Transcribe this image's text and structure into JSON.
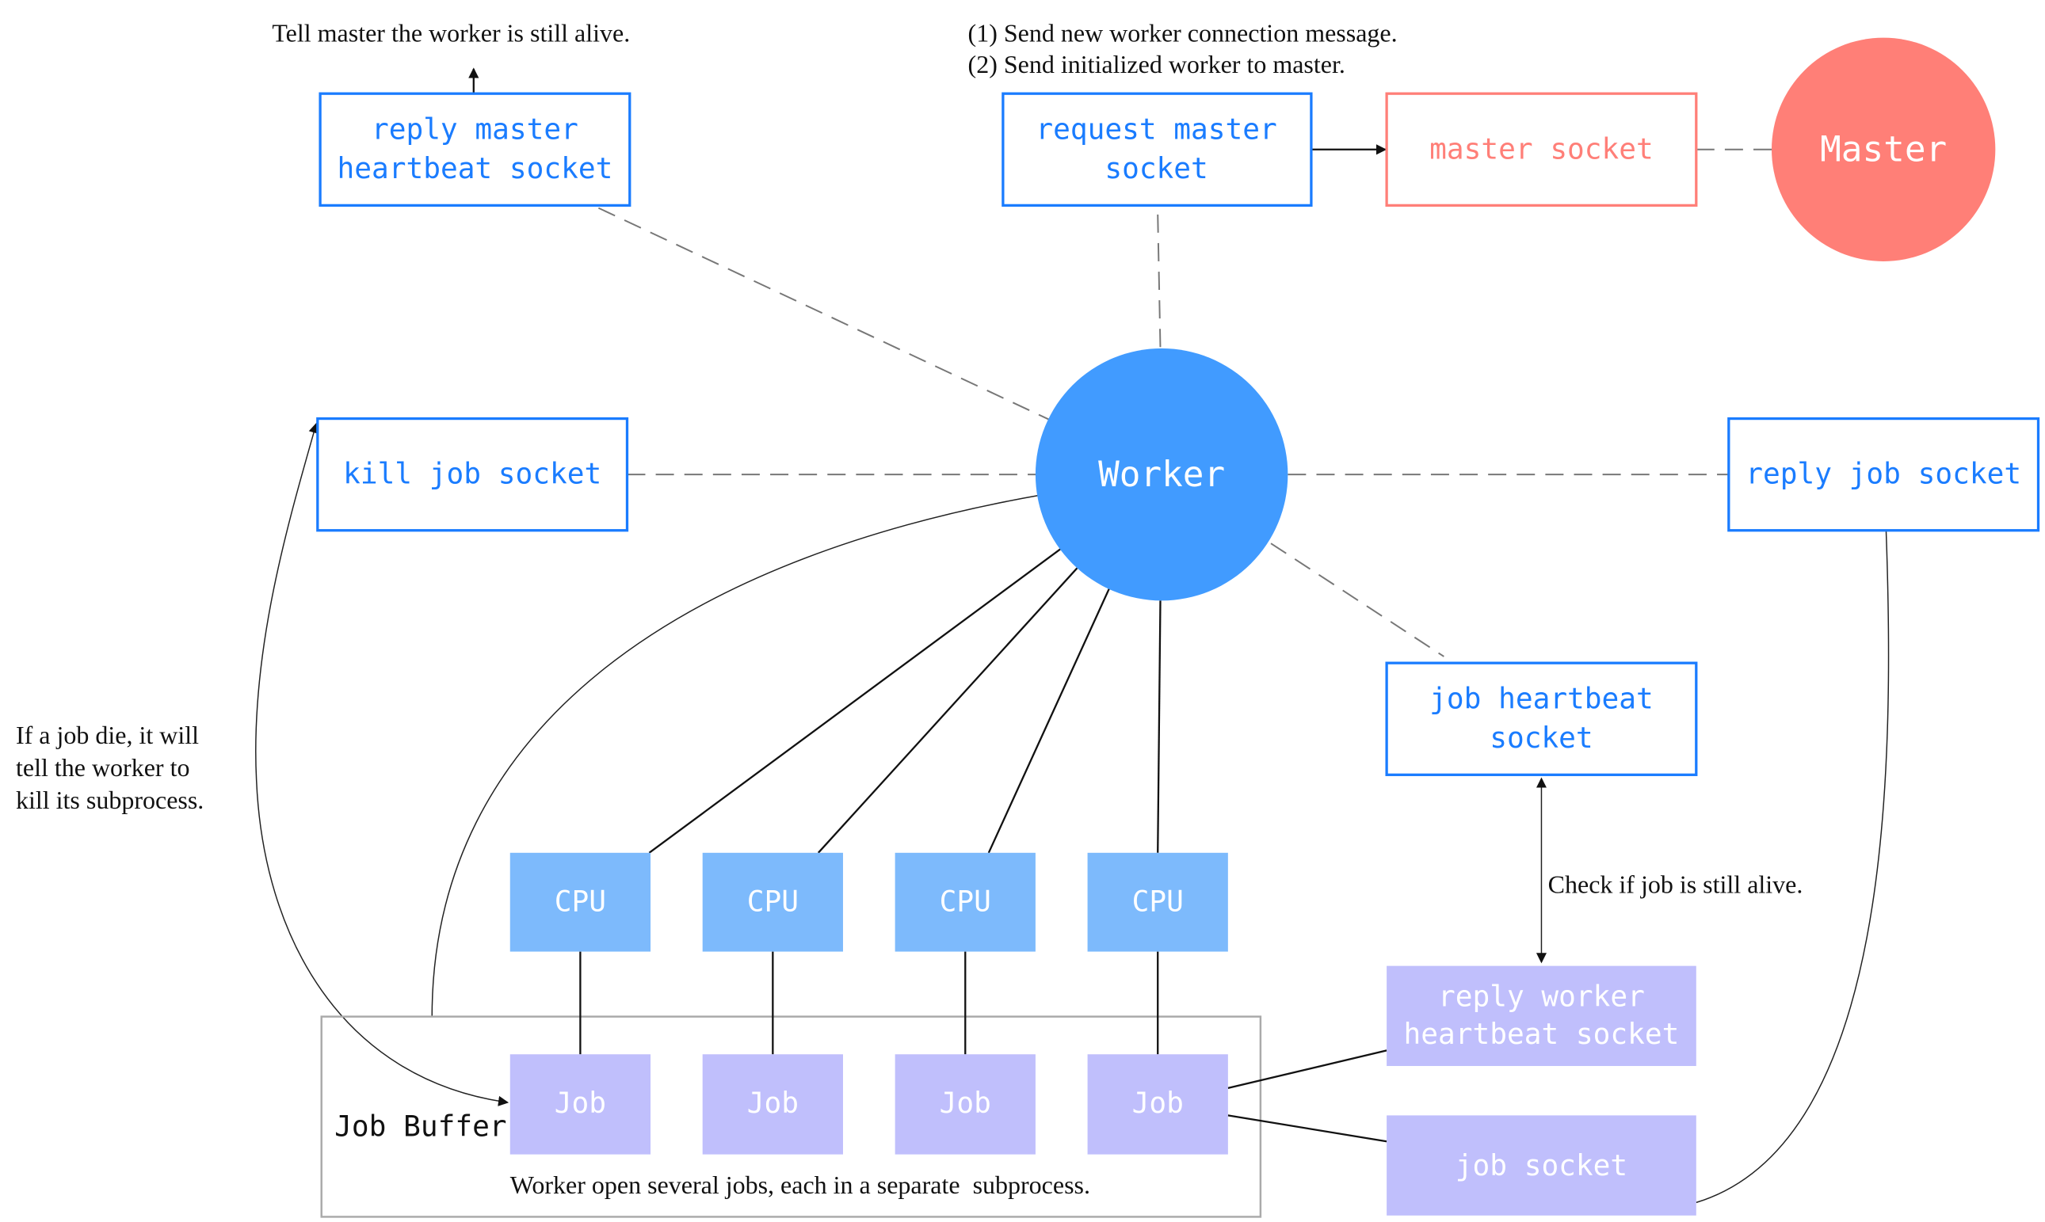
{
  "notes": {
    "heartbeat": "Tell master the worker is still alive.",
    "request_1": "(1) Send new worker connection message.",
    "request_2": "(2) Send initialized worker to master.",
    "job_die_1": "If a job die, it will",
    "job_die_2": "tell the worker to",
    "job_die_3": "kill its subprocess.",
    "check_alive": "Check if job is still alive.",
    "buffer_caption": "Worker open several jobs, each in a separate  subprocess."
  },
  "nodes": {
    "reply_master_heartbeat": [
      "reply master",
      "heartbeat socket"
    ],
    "request_master": [
      "request master",
      "socket"
    ],
    "master_socket": "master socket",
    "master": "Master",
    "worker": "Worker",
    "kill_job": "kill job socket",
    "reply_job": "reply job socket",
    "job_heartbeat": [
      "job heartbeat",
      "socket"
    ],
    "reply_worker_heartbeat": [
      "reply worker",
      "heartbeat socket"
    ],
    "job_socket": "job socket",
    "job_buffer": "Job Buffer",
    "cpus": [
      "CPU",
      "CPU",
      "CPU",
      "CPU"
    ],
    "jobs": [
      "Job",
      "Job",
      "Job",
      "Job"
    ]
  },
  "colors": {
    "socket_blue": "#1a7cff",
    "master_red": "#ff7f78",
    "worker_blue": "#419bff",
    "cpu_blue": "#7dbafc",
    "job_purple": "#c0bffc"
  }
}
